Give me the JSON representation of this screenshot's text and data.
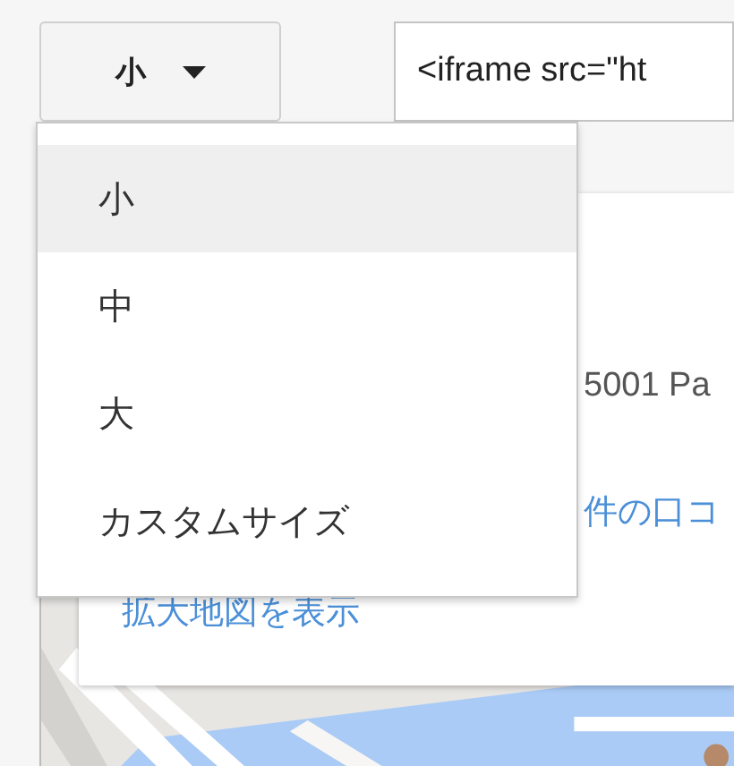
{
  "size_select": {
    "value": "小",
    "expanded": true
  },
  "embed_code": {
    "value": "<iframe src=\"ht"
  },
  "size_menu": {
    "items": [
      {
        "label": "小",
        "selected": true
      },
      {
        "label": "中",
        "selected": false
      },
      {
        "label": "大",
        "selected": false
      },
      {
        "label": "カスタムサイズ",
        "selected": false
      }
    ]
  },
  "map_preview": {
    "address": "5001 Pa",
    "reviews_link": "件の口コ",
    "larger_map_link": "拡大地図を表示"
  }
}
